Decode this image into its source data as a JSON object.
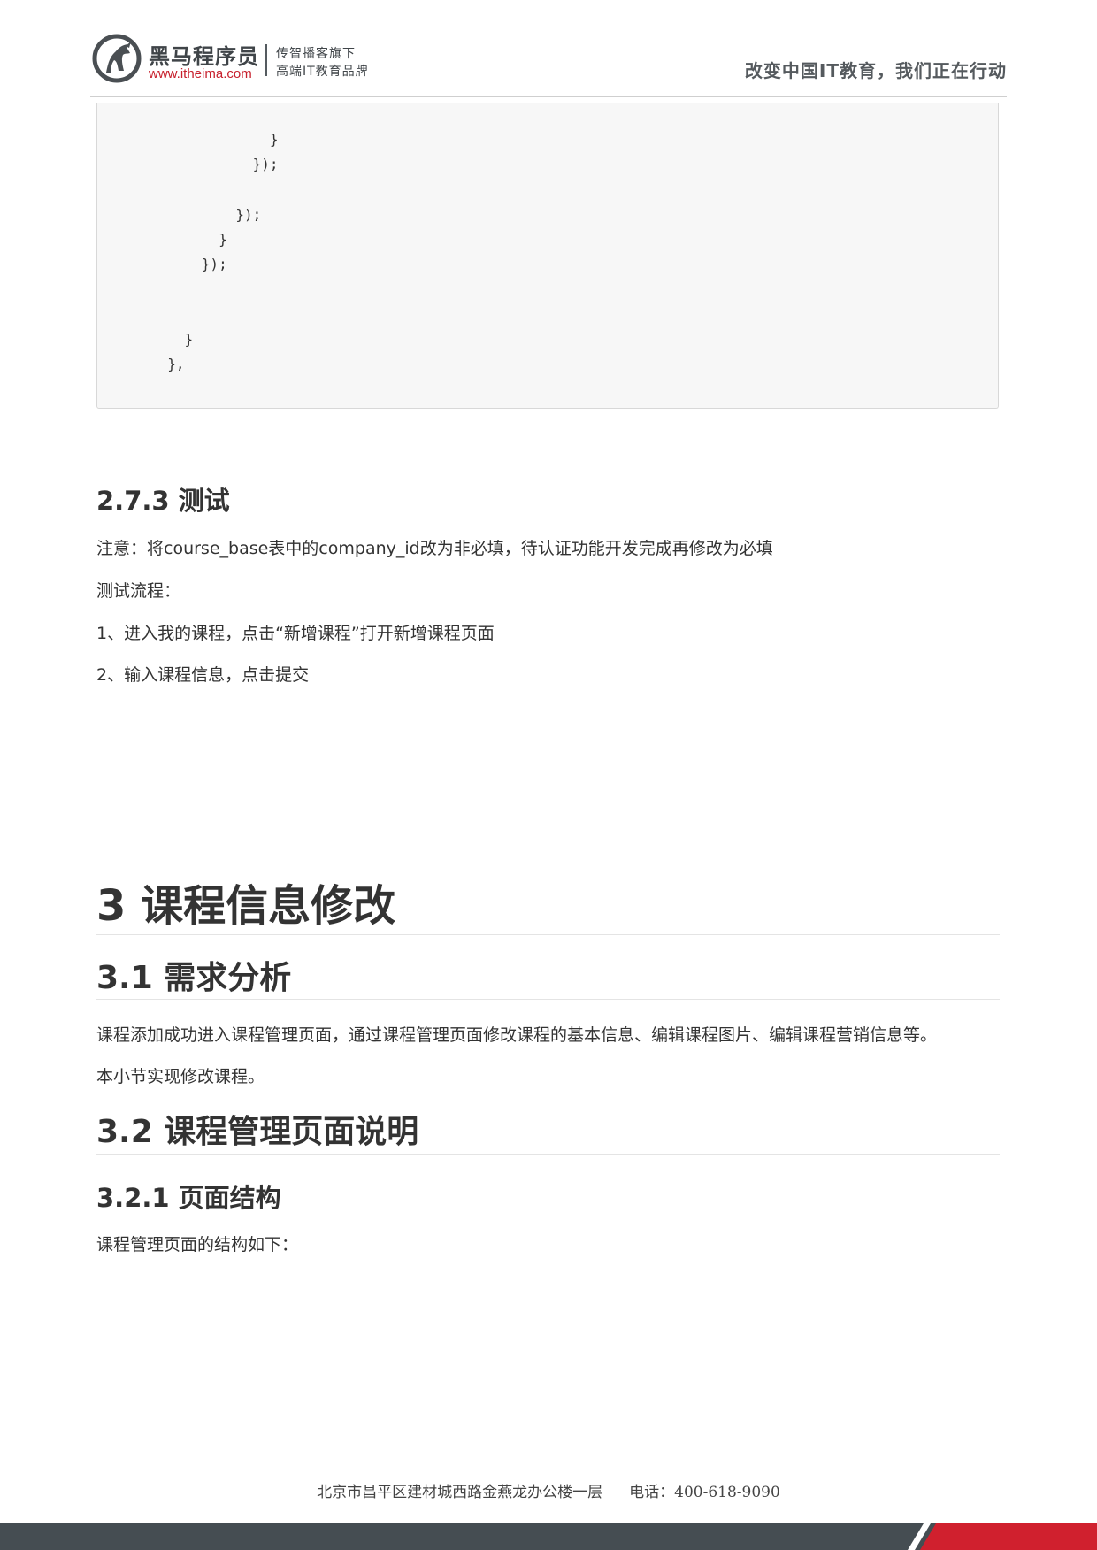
{
  "header": {
    "brand_name": "黑马程序员",
    "brand_url": "www.itheima.com",
    "brand_sub1": "传智播客旗下",
    "brand_sub2": "高端IT教育品牌",
    "slogan": "改变中国IT教育，我们正在行动",
    "colors": {
      "brand_red": "#c7202d",
      "brand_gray": "#3f4448"
    }
  },
  "code_block": {
    "text": "              }\n            });\n\n          });\n        }\n      });\n\n\n    }\n  },"
  },
  "section_273": {
    "heading": "2.7.3 测试",
    "note": "注意：将course_base表中的company_id改为非必填，待认证功能开发完成再修改为必填",
    "flow_label": "测试流程：",
    "step1": "1、进入我的课程，点击“新增课程”打开新增课程页面",
    "step2": "2、输入课程信息，点击提交"
  },
  "section_3": {
    "heading": "3 课程信息修改"
  },
  "section_31": {
    "heading": "3.1 需求分析",
    "para1": "课程添加成功进入课程管理页面，通过课程管理页面修改课程的基本信息、编辑课程图片、编辑课程营销信息等。",
    "para2": "本小节实现修改课程。"
  },
  "section_32": {
    "heading": "3.2 课程管理页面说明"
  },
  "section_321": {
    "heading": "3.2.1 页面结构",
    "para": "课程管理页面的结构如下："
  },
  "footer": {
    "address": "北京市昌平区建材城西路金燕龙办公楼一层",
    "phone": "电话：400-618-9090",
    "colors": {
      "bar_gray": "#454d52",
      "bar_red": "#d0202e"
    }
  }
}
